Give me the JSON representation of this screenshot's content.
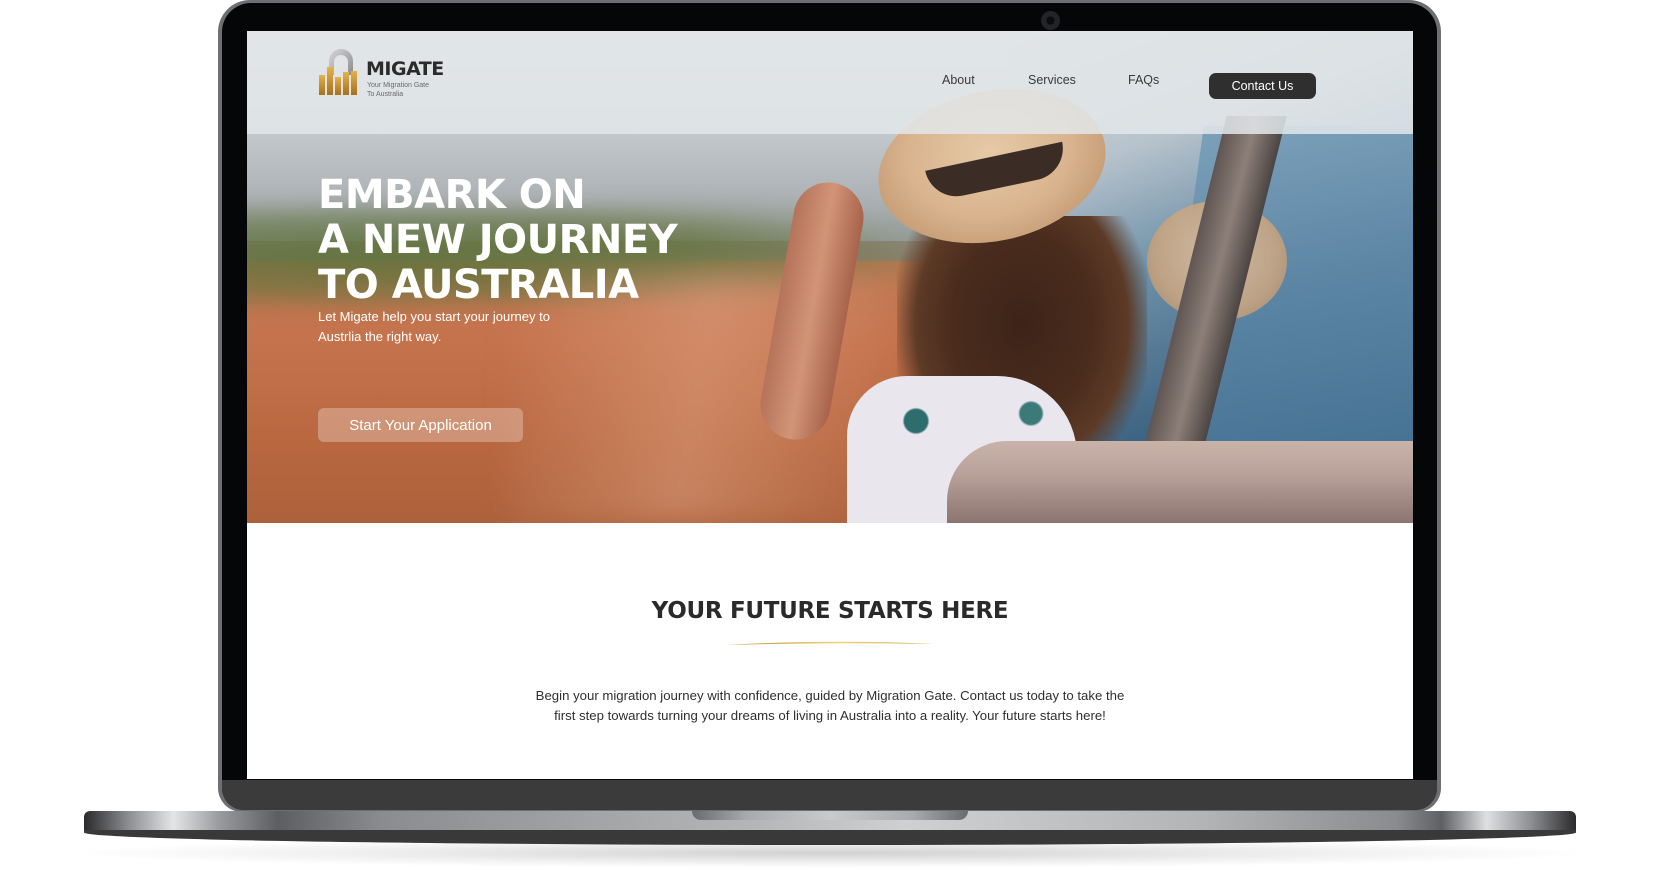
{
  "header": {
    "logo": {
      "title": "MIGATE",
      "tagline_line1": "Your Migration Gate",
      "tagline_line2": "To Australia"
    },
    "nav": [
      {
        "label": "About"
      },
      {
        "label": "Services"
      },
      {
        "label": "FAQs"
      }
    ],
    "contact_label": "Contact Us"
  },
  "hero": {
    "title_lines": [
      "EMBARK ON",
      "A NEW JOURNEY",
      "TO AUSTRALIA"
    ],
    "subtitle_lines": [
      "Let Migate help you start your journey to",
      "Austrlia the right way."
    ],
    "cta_label": "Start Your Application"
  },
  "section": {
    "title": "YOUR FUTURE STARTS HERE",
    "body": "Begin your migration journey with confidence, guided by Migration Gate. Contact us today to take the first step towards turning your dreams of living in Australia into a reality. Your future starts here!"
  },
  "colors": {
    "brand_gold": "#c8922a",
    "dark": "#2f2f2f",
    "header_bg": "#e2e6e9",
    "hero_accent": "#b8673f"
  }
}
